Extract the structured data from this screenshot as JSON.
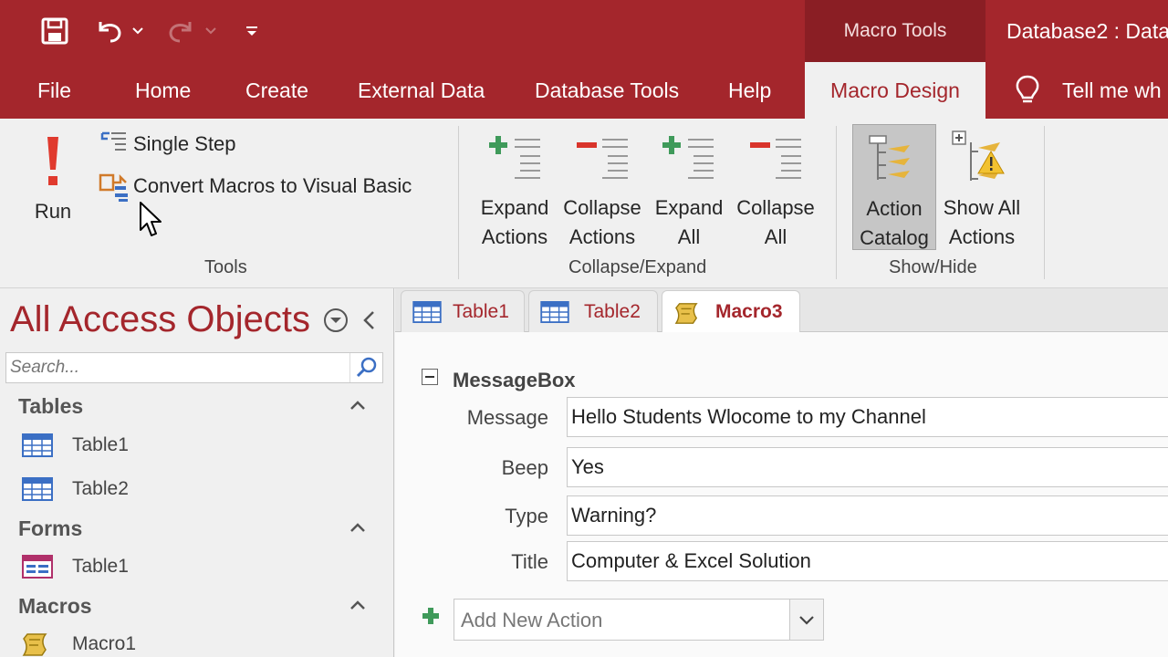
{
  "title_bar": {
    "context_label": "Macro Tools",
    "document_title": "Database2 : Data"
  },
  "tabs": [
    {
      "label": "File"
    },
    {
      "label": "Home"
    },
    {
      "label": "Create"
    },
    {
      "label": "External Data"
    },
    {
      "label": "Database Tools"
    },
    {
      "label": "Help"
    },
    {
      "label": "Macro Design",
      "active": true
    }
  ],
  "tell_me": "Tell me wh",
  "ribbon": {
    "tools": {
      "run": "Run",
      "single_step": "Single Step",
      "convert": "Convert Macros to Visual Basic",
      "group": "Tools"
    },
    "collapse_expand": {
      "expand_actions": [
        "Expand",
        "Actions"
      ],
      "collapse_actions": [
        "Collapse",
        "Actions"
      ],
      "expand_all": [
        "Expand",
        "All"
      ],
      "collapse_all": [
        "Collapse",
        "All"
      ],
      "group": "Collapse/Expand"
    },
    "show_hide": {
      "action_catalog": [
        "Action",
        "Catalog"
      ],
      "show_all_actions": [
        "Show All",
        "Actions"
      ],
      "group": "Show/Hide"
    }
  },
  "nav_pane": {
    "title": "All Access Objects",
    "search_placeholder": "Search...",
    "sections": [
      {
        "name": "Tables",
        "items": [
          "Table1",
          "Table2"
        ]
      },
      {
        "name": "Forms",
        "items": [
          "Table1"
        ]
      },
      {
        "name": "Macros",
        "items": [
          "Macro1"
        ]
      }
    ]
  },
  "doc_tabs": [
    {
      "label": "Table1",
      "icon": "table-icon"
    },
    {
      "label": "Table2",
      "icon": "table-icon"
    },
    {
      "label": "Macro3",
      "icon": "macro-icon",
      "active": true
    }
  ],
  "macro": {
    "action": "MessageBox",
    "arguments": [
      {
        "label": "Message",
        "value": "Hello Students Wlocome to my Channel"
      },
      {
        "label": "Beep",
        "value": "Yes"
      },
      {
        "label": "Type",
        "value": "Warning?"
      },
      {
        "label": "Title",
        "value": "Computer & Excel Solution"
      }
    ],
    "add_new_action": "Add New Action"
  },
  "colors": {
    "accent": "#a4262c",
    "context_band": "#8a1e24",
    "plus_green": "#3f9a5a",
    "minus_red": "#d9342b"
  }
}
